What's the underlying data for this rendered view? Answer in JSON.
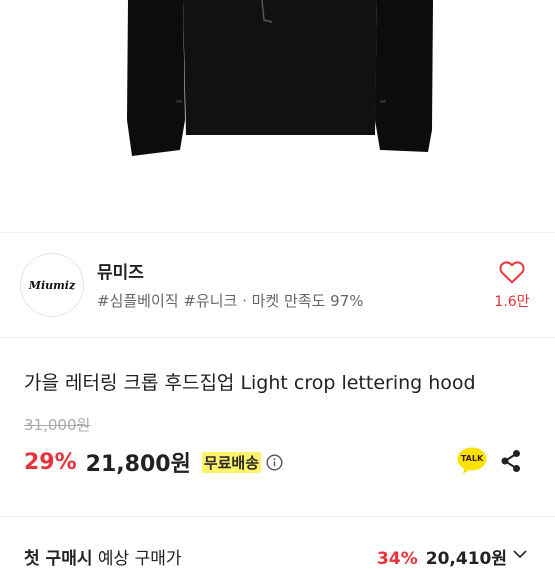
{
  "shop": {
    "logo_text": "Miumiz",
    "name": "뮤미즈",
    "tags": "#심플베이직 #유니크 · 마켓 만족도 97%",
    "like_count": "1.6만"
  },
  "product": {
    "title": "가을 레터링 크롭 후드집업 Light crop lettering hood",
    "original_price": "31,000원",
    "discount": "29%",
    "price": "21,800원",
    "shipping_badge": "무료배송",
    "talk_label": "TALK"
  },
  "first_purchase": {
    "label_strong": "첫 구매시",
    "label_rest": " 예상 구매가",
    "discount": "34%",
    "price": "20,410원"
  },
  "colors": {
    "accent_red": "#e8323c",
    "kakao_yellow": "#fae100",
    "badge_yellow": "#fff36a"
  }
}
